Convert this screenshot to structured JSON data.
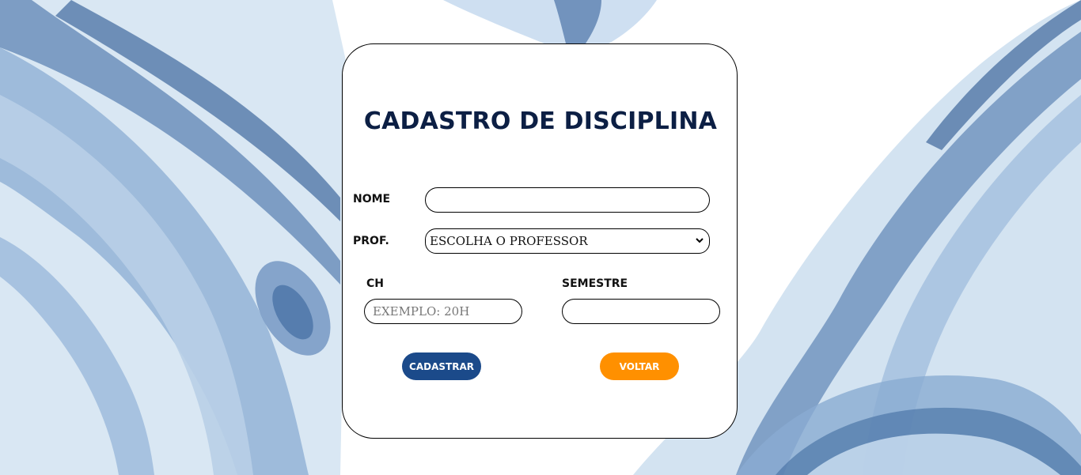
{
  "form": {
    "title": "CADASTRO DE DISCIPLINA",
    "nome_label": "NOME",
    "nome_value": "",
    "prof_label": "PROF.",
    "prof_selected": "ESCOLHA O PROFESSOR",
    "ch_label": "CH",
    "ch_placeholder": "EXEMPLO: 20H",
    "semestre_label": "SEMESTRE",
    "semestre_value": ""
  },
  "buttons": {
    "submit_label": "CADASTRAR",
    "back_label": "VOLTAR"
  },
  "colors": {
    "title": "#0c1f44",
    "submit_bg": "#1b4a8a",
    "back_bg": "#ff9000",
    "watercolor_dark": "#4f77a8",
    "watercolor_light": "#c9dcef"
  }
}
